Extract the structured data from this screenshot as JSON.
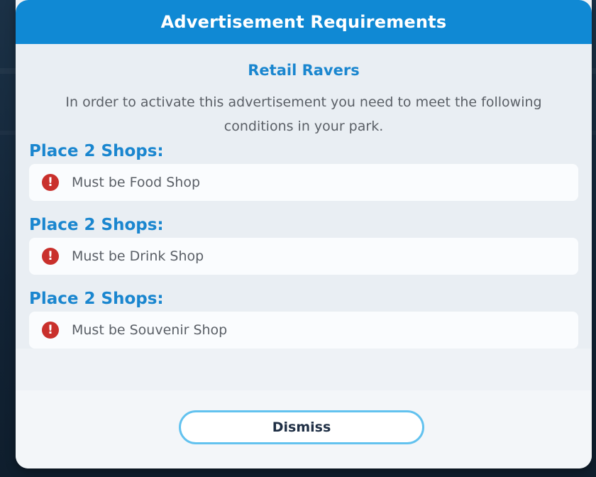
{
  "dialog": {
    "title": "Advertisement Requirements",
    "subtitle": "Retail Ravers",
    "description": "In order to activate this advertisement you need to meet the following conditions in your park.",
    "requirements": [
      {
        "heading": "Place 2 Shops:",
        "condition": "Must be Food Shop",
        "status_icon": "error-exclamation-icon"
      },
      {
        "heading": "Place 2 Shops:",
        "condition": "Must be Drink Shop",
        "status_icon": "error-exclamation-icon"
      },
      {
        "heading": "Place 2 Shops:",
        "condition": "Must be Souvenir Shop",
        "status_icon": "error-exclamation-icon"
      }
    ],
    "dismiss_label": "Dismiss"
  },
  "colors": {
    "title_bar": "#1089d4",
    "accent_text": "#1a86cf",
    "error": "#c9302c",
    "button_border": "#62c2ef"
  },
  "icons": {
    "error": "!"
  }
}
